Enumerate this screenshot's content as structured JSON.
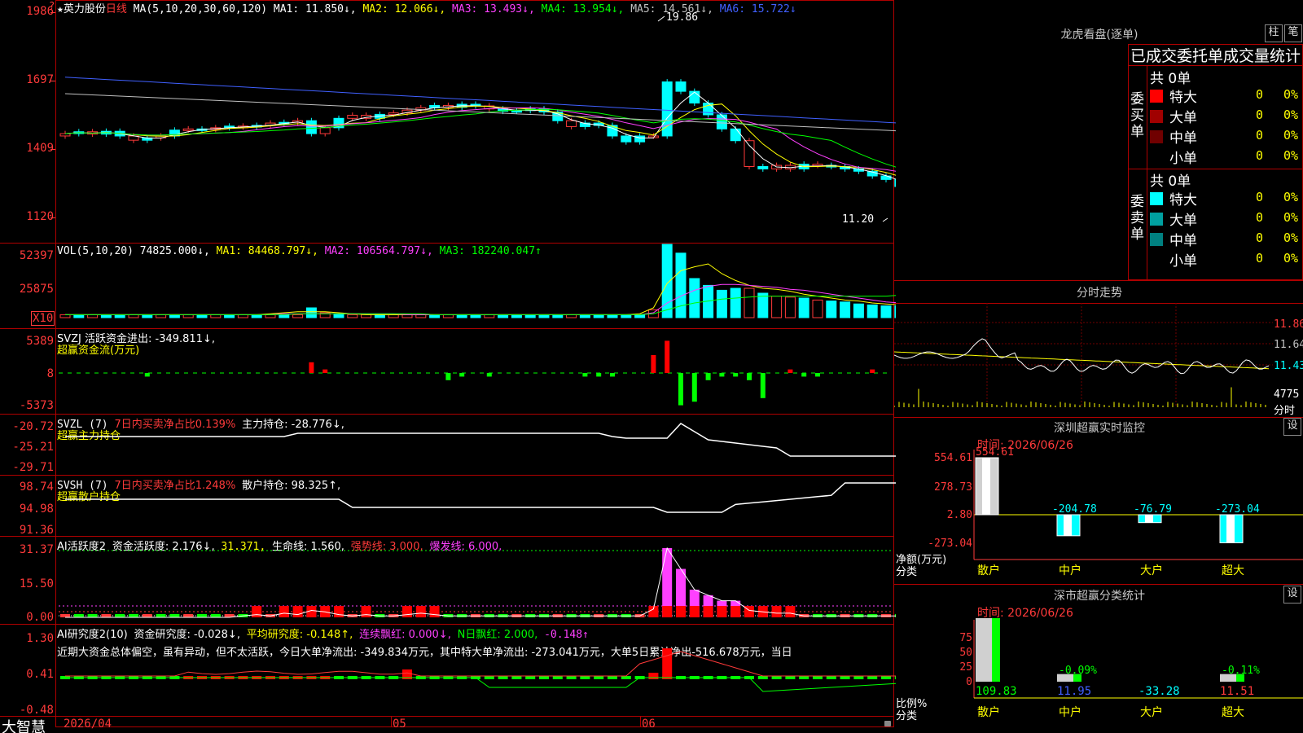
{
  "stock": {
    "name": "英力股份",
    "period": "日线",
    "ma_params": "MA(5,10,20,30,60,120)",
    "ma_values": [
      {
        "label": "MA1: 11.850↓,",
        "color": "#ffffff"
      },
      {
        "label": "MA2: 12.066↓,",
        "color": "#ffff00"
      },
      {
        "label": "MA3: 13.493↓,",
        "color": "#ff40ff"
      },
      {
        "label": "MA4: 13.954↓,",
        "color": "#00ff00"
      },
      {
        "label": "MA5: 14.561↓,",
        "color": "#c0c0c0"
      },
      {
        "label": "MA6: 15.722↓",
        "color": "#4060ff"
      }
    ],
    "high_marker": "19.86",
    "low_marker": "11.20"
  },
  "price_axis": [
    "1986",
    "1697",
    "1409",
    "1120"
  ],
  "vol": {
    "header": "VOL(5,10,20)",
    "value": "74825.000↓,",
    "ma1": "MA1: 84468.797↓,",
    "ma2": "MA2: 106564.797↓,",
    "ma3": "MA3: 182240.047↑",
    "axis": [
      "52397",
      "25875"
    ],
    "mult": "X10",
    "bars": [
      3,
      3,
      3,
      3,
      3,
      3,
      3,
      3,
      3,
      3,
      3,
      3,
      3,
      3,
      3,
      3,
      3,
      3,
      10,
      5,
      4,
      3,
      3,
      3,
      3,
      3,
      3,
      3,
      3,
      3,
      3,
      3,
      3,
      3,
      3,
      3,
      3,
      3,
      3,
      3,
      3,
      3,
      3,
      8,
      75,
      66,
      40,
      33,
      28,
      30,
      30,
      25,
      22,
      21,
      20,
      18,
      17,
      16,
      14,
      13,
      12,
      12
    ],
    "up": [
      1,
      0,
      1,
      0,
      0,
      1,
      0,
      1,
      0,
      1,
      0,
      1,
      0,
      1,
      0,
      1,
      0,
      1,
      0,
      1,
      0,
      1,
      1,
      0,
      1,
      1,
      1,
      0,
      1,
      0,
      0,
      1,
      0,
      0,
      0,
      0,
      0,
      1,
      0,
      0,
      0,
      0,
      0,
      1,
      0,
      0,
      0,
      0,
      0,
      0,
      1,
      0,
      1,
      1,
      0,
      1,
      0,
      0,
      0,
      0,
      0,
      0
    ],
    "ma_a": [
      3,
      3,
      3,
      3,
      3,
      3,
      3,
      3,
      3,
      3,
      3,
      3,
      3,
      3,
      3,
      4,
      5,
      6,
      6,
      6,
      5,
      4,
      3,
      3,
      3,
      3,
      3,
      3,
      3,
      3,
      3,
      3,
      3,
      3,
      3,
      3,
      3,
      3,
      3,
      3,
      3,
      3,
      4,
      10,
      35,
      48,
      52,
      55,
      45,
      38,
      33,
      30,
      29,
      27,
      24,
      22,
      20,
      18,
      17,
      15,
      14,
      13
    ],
    "ma_b": [
      3,
      3,
      3,
      3,
      3,
      3,
      3,
      3,
      3,
      3,
      3,
      3,
      3,
      3,
      3,
      3,
      4,
      4,
      4,
      4,
      4,
      4,
      4,
      4,
      4,
      3,
      3,
      3,
      3,
      3,
      3,
      3,
      3,
      3,
      3,
      3,
      3,
      3,
      3,
      3,
      3,
      3,
      3,
      5,
      15,
      22,
      28,
      32,
      34,
      34,
      33,
      32,
      31,
      29,
      28,
      26,
      24,
      22,
      20,
      18,
      16,
      15
    ],
    "ma_c": [
      3,
      3,
      3,
      3,
      3,
      3,
      3,
      3,
      3,
      3,
      3,
      3,
      3,
      3,
      3,
      3,
      3,
      4,
      4,
      4,
      4,
      4,
      4,
      4,
      4,
      4,
      4,
      3,
      3,
      3,
      3,
      3,
      3,
      3,
      3,
      3,
      3,
      3,
      3,
      3,
      3,
      3,
      3,
      4,
      8,
      12,
      15,
      17,
      19,
      20,
      21,
      22,
      22,
      22,
      22,
      22,
      22,
      22,
      22,
      22,
      22,
      23
    ]
  },
  "svzj": {
    "header": "SVZJ  活跃资金进出: -349.811↓,",
    "sub": "超赢资金流(万元)",
    "axis": [
      "5389",
      "8",
      "-5373"
    ],
    "bars": [
      0,
      0,
      0,
      0,
      0,
      0,
      -1,
      0,
      0,
      0,
      0,
      0,
      0,
      0,
      0,
      0,
      0,
      0,
      3,
      1,
      0,
      0,
      0,
      0,
      0,
      0,
      0,
      0,
      -2,
      -1,
      0,
      -1,
      0,
      0,
      0,
      0,
      0,
      0,
      -1,
      -1,
      -1,
      0,
      0,
      5,
      9,
      -9,
      -8,
      -2,
      -1,
      -1,
      -2,
      -7,
      0,
      1,
      -1,
      -1,
      0,
      0,
      0,
      1,
      0,
      0
    ]
  },
  "svzl": {
    "header": "SVZL (7)",
    "pct": "7日内买卖净占比0.139%",
    "hold": "主力持仓: -28.776↓,",
    "sub": "超赢主力持仓",
    "axis": [
      "-20.72",
      "-25.21",
      "-29.71"
    ]
  },
  "svsh": {
    "header": "SVSH (7)",
    "pct": "7日内买卖净占比1.248%",
    "hold": "散户持仓: 98.325↑,",
    "sub": "超赢散户持仓",
    "axis": [
      "98.74",
      "94.98",
      "91.36"
    ]
  },
  "ai1": {
    "header": "AI活跃度2",
    "label": "资金活跃度: 2.176↓,",
    "v2": "31.371,",
    "life": "生命线: 1.560,",
    "strong": "强势线: 3.000,",
    "burst": "爆发线: 6.000,",
    "axis": [
      "31.37",
      "15.50",
      "0.00"
    ],
    "bars": [
      0,
      0,
      0,
      0,
      0,
      0,
      0,
      0,
      0,
      0,
      0,
      0,
      0,
      1,
      2,
      1,
      3,
      2,
      5,
      4,
      2,
      1,
      2,
      1,
      1,
      2,
      3,
      2,
      1,
      1,
      1,
      1,
      1,
      1,
      1,
      1,
      1,
      1,
      1,
      1,
      1,
      1,
      1,
      6,
      50,
      35,
      20,
      16,
      12,
      12,
      5,
      4,
      3,
      3,
      1,
      1,
      1,
      1,
      1,
      1,
      1,
      1
    ]
  },
  "ai2": {
    "header": "AI研究度2(10)",
    "label": "资金研究度: -0.028↓,",
    "avg": "平均研究度: -0.148↑,",
    "red": "连续飘红: 0.000↓,",
    "nred": "N日飘红: 2.000,",
    "v5": "-0.148↑",
    "comment": "近期大资金总体偏空，虽有异动，但不太活跃，今日大单净流出: -349.834万元，其中特大单净流出: -273.041万元，大单5日累计净出-516.678万元，当日",
    "axis": [
      "1.30",
      "0.41",
      "-0.48"
    ]
  },
  "dates": [
    "2026/04",
    "05",
    "06"
  ],
  "footer_brand": "大智慧",
  "right": {
    "lh_title": "龙虎看盘(逐单)",
    "btn_zhu": "柱",
    "btn_bi": "笔",
    "stats_title": "已成交委托单成交量统计",
    "buy": {
      "side": "委买单",
      "total": "共 0单",
      "rows": [
        {
          "name": "特大",
          "val": "0",
          "pct": "0%",
          "color": "#ff0000"
        },
        {
          "name": "大单",
          "val": "0",
          "pct": "0%",
          "color": "#a00000"
        },
        {
          "name": "中单",
          "val": "0",
          "pct": "0%",
          "color": "#700000"
        },
        {
          "name": "小单",
          "val": "0",
          "pct": "0%",
          "color": "#000000"
        }
      ]
    },
    "sell": {
      "side": "委卖单",
      "total": "共 0单",
      "rows": [
        {
          "name": "特大",
          "val": "0",
          "pct": "0%",
          "color": "#00ffff"
        },
        {
          "name": "大单",
          "val": "0",
          "pct": "0%",
          "color": "#00a0a0"
        },
        {
          "name": "中单",
          "val": "0",
          "pct": "0%",
          "color": "#008080"
        },
        {
          "name": "小单",
          "val": "0",
          "pct": "0%",
          "color": "#000000"
        }
      ]
    },
    "intraday_title": "分时走势",
    "intraday_axis": [
      "11.86",
      "11.64",
      "11.43",
      "4775",
      "分时"
    ],
    "monitor_title": "深圳超赢实时监控",
    "monitor_btn": "设",
    "monitor_time": "时间: 2026/06/26",
    "monitor_axis": [
      "554.61",
      "278.73",
      "2.80",
      "-273.04"
    ],
    "monitor_ylabel": [
      "净额(万元)",
      "分类"
    ],
    "monitor_bars": [
      {
        "cat": "散户",
        "value": 554.61,
        "label": "554.61"
      },
      {
        "cat": "中户",
        "value": -204.78,
        "label": "-204.78"
      },
      {
        "cat": "大户",
        "value": -76.79,
        "label": "-76.79"
      },
      {
        "cat": "超大",
        "value": -273.04,
        "label": "-273.04"
      }
    ],
    "class_title": "深市超赢分类统计",
    "class_btn": "设",
    "class_time": "时间: 2026/06/26",
    "class_axis": [
      "75",
      "50",
      "25",
      "0"
    ],
    "class_ylabel": [
      "比例%",
      "分类"
    ],
    "class_bars": [
      {
        "cat": "散户",
        "bottom": "109.83",
        "top": "",
        "pct": 100
      },
      {
        "cat": "中户",
        "bottom": "11.95",
        "top": "-0.09%",
        "pct": 12
      },
      {
        "cat": "大户",
        "bottom": "-33.28",
        "top": "",
        "pct": 0
      },
      {
        "cat": "超大",
        "bottom": "11.51",
        "top": "-0.11%",
        "pct": 12
      }
    ]
  }
}
